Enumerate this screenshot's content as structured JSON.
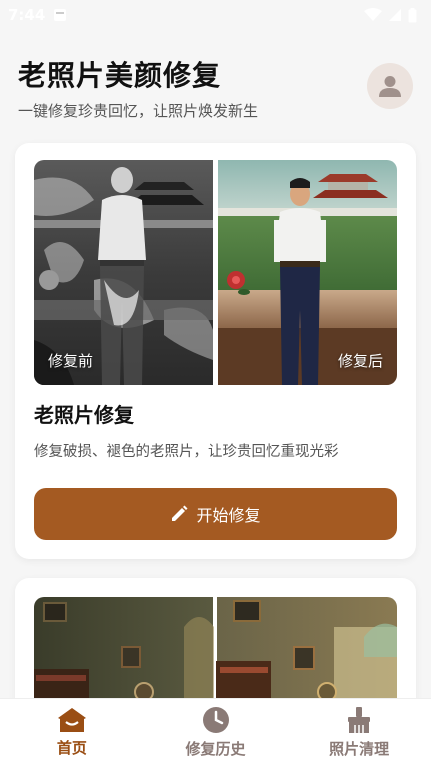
{
  "status_bar": {
    "time": "7:44"
  },
  "header": {
    "title": "老照片美颜修复",
    "subtitle": "一键修复珍贵回忆，让照片焕发新生",
    "avatar_icon": "user-icon"
  },
  "card_restore": {
    "before_label": "修复前",
    "after_label": "修复后",
    "title": "老照片修复",
    "description": "修复破损、褪色的老照片，让珍贵回忆重现光彩",
    "button_label": "开始修复",
    "button_icon": "pencil-icon",
    "accent_color": "#a45a22"
  },
  "bottom_nav": {
    "items": [
      {
        "label": "首页",
        "icon": "home-icon",
        "active": true
      },
      {
        "label": "修复历史",
        "icon": "clock-icon",
        "active": false
      },
      {
        "label": "照片清理",
        "icon": "broom-icon",
        "active": false
      }
    ],
    "active_color": "#9a4e14",
    "inactive_color": "#8a7a76"
  }
}
